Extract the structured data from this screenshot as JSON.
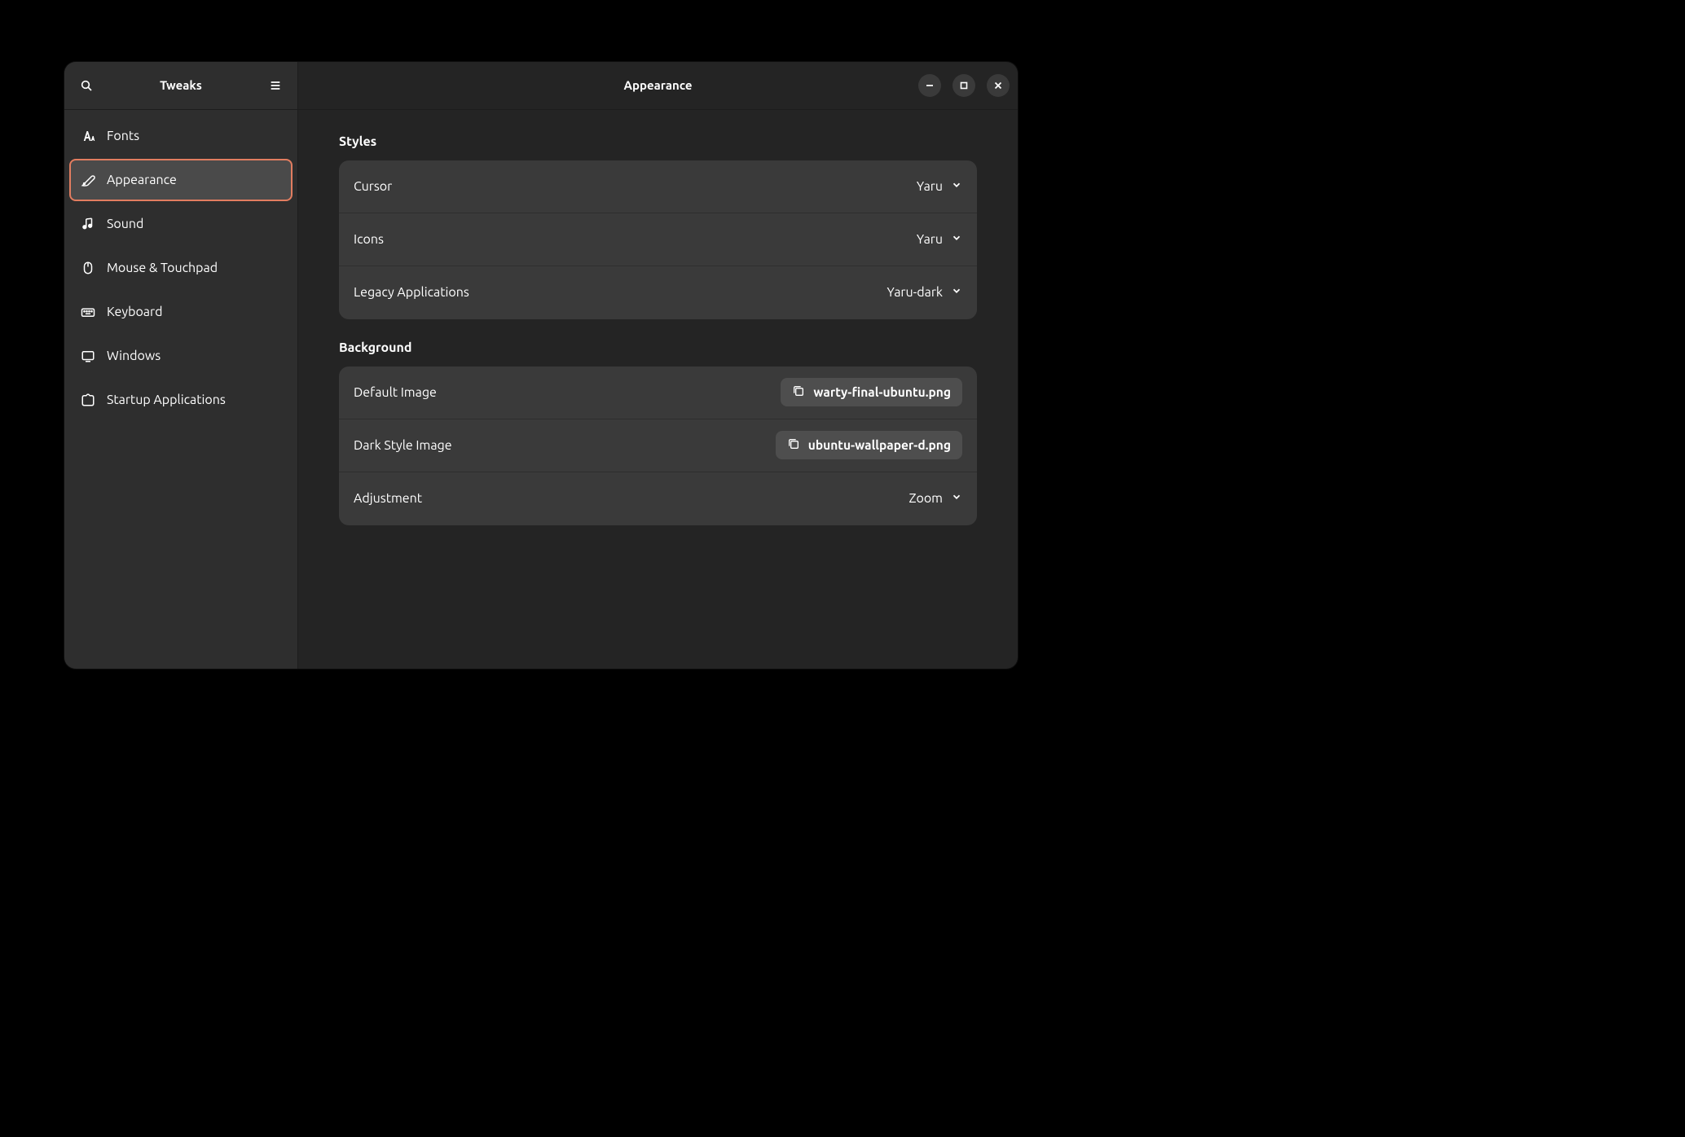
{
  "sidebar": {
    "title": "Tweaks",
    "items": [
      {
        "id": "fonts",
        "label": "Fonts"
      },
      {
        "id": "appearance",
        "label": "Appearance"
      },
      {
        "id": "sound",
        "label": "Sound"
      },
      {
        "id": "mouse-touchpad",
        "label": "Mouse & Touchpad"
      },
      {
        "id": "keyboard",
        "label": "Keyboard"
      },
      {
        "id": "windows",
        "label": "Windows"
      },
      {
        "id": "startup-applications",
        "label": "Startup Applications"
      }
    ],
    "active": "appearance"
  },
  "main": {
    "title": "Appearance",
    "sections": {
      "styles": {
        "heading": "Styles",
        "rows": [
          {
            "label": "Cursor",
            "value": "Yaru"
          },
          {
            "label": "Icons",
            "value": "Yaru"
          },
          {
            "label": "Legacy Applications",
            "value": "Yaru-dark"
          }
        ]
      },
      "background": {
        "heading": "Background",
        "default_image": {
          "label": "Default Image",
          "file": "warty-final-ubuntu.png"
        },
        "dark_style_image": {
          "label": "Dark Style Image",
          "file": "ubuntu-wallpaper-d.png"
        },
        "adjustment": {
          "label": "Adjustment",
          "value": "Zoom"
        }
      }
    }
  }
}
